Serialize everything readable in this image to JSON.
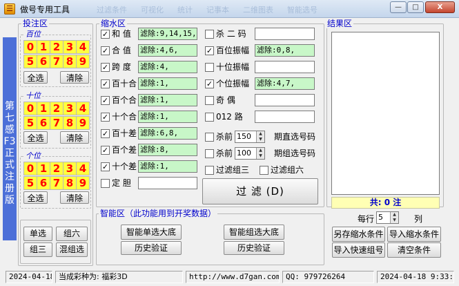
{
  "window": {
    "title": "做号专用工具",
    "app_icon_glyph": "☰",
    "min": "—",
    "max": "□",
    "close": "X"
  },
  "tabs": {
    "items": [
      "过滤条件",
      "可视化",
      "统计",
      "记事本",
      "二维图表",
      "智能选号"
    ]
  },
  "vertical_label": "第七感F3 正式注册版",
  "bet_area": {
    "title": "投注区",
    "groups": [
      {
        "label": "百位",
        "digits": [
          "0",
          "1",
          "2",
          "3",
          "4",
          "5",
          "6",
          "7",
          "8",
          "9"
        ],
        "select_all": "全选",
        "clear": "清除"
      },
      {
        "label": "十位",
        "digits": [
          "0",
          "1",
          "2",
          "3",
          "4",
          "5",
          "6",
          "7",
          "8",
          "9"
        ],
        "select_all": "全选",
        "clear": "清除"
      },
      {
        "label": "个位",
        "digits": [
          "0",
          "1",
          "2",
          "3",
          "4",
          "5",
          "6",
          "7",
          "8",
          "9"
        ],
        "select_all": "全选",
        "clear": "清除"
      }
    ],
    "buttons": {
      "single": "单选",
      "group6": "组六",
      "group3": "组三",
      "mixed": "混组选"
    }
  },
  "filter_area": {
    "title": "缩水区",
    "left": [
      {
        "checked": true,
        "label": "和  值",
        "value": "滤除:9,14,15,"
      },
      {
        "checked": true,
        "label": "合  值",
        "value": "滤除:4,6,"
      },
      {
        "checked": true,
        "label": "跨  度",
        "value": "滤除:4,"
      },
      {
        "checked": true,
        "label": "百十合",
        "value": "滤除:1,"
      },
      {
        "checked": true,
        "label": "百个合",
        "value": "滤除:1,"
      },
      {
        "checked": true,
        "label": "十个合",
        "value": "滤除:1,"
      },
      {
        "checked": true,
        "label": "百十差",
        "value": "滤除:6,8,"
      },
      {
        "checked": true,
        "label": "百个差",
        "value": "滤除:8,"
      },
      {
        "checked": true,
        "label": "十个差",
        "value": "滤除:1,"
      },
      {
        "checked": false,
        "label": "定  胆",
        "value": ""
      }
    ],
    "right": [
      {
        "checked": false,
        "label": "杀 二 码",
        "value": ""
      },
      {
        "checked": true,
        "label": "百位振幅",
        "value": "滤除:0,8,"
      },
      {
        "checked": false,
        "label": "十位振幅",
        "value": ""
      },
      {
        "checked": true,
        "label": "个位振幅",
        "value": "滤除:4,7,"
      },
      {
        "checked": false,
        "label": "奇  偶",
        "value": ""
      },
      {
        "checked": false,
        "label": "012 路",
        "value": ""
      }
    ],
    "kill_rows": [
      {
        "checked": false,
        "prefix": "杀前",
        "value": "150",
        "suffix": "期直选号码"
      },
      {
        "checked": false,
        "prefix": "杀前",
        "value": "100",
        "suffix": "期组选号码"
      }
    ],
    "filter_g3": {
      "checked": false,
      "label": "过滤组三"
    },
    "filter_g6": {
      "checked": false,
      "label": "过滤组六"
    },
    "filter_button": "过  滤 (D)"
  },
  "smart_area": {
    "title": "智能区（此功能用到开奖数据）",
    "single_btn": "智能单选大底",
    "single_verify": "历史验证",
    "group_btn": "智能组选大底",
    "group_verify": "历史验证"
  },
  "result_area": {
    "title": "结果区",
    "total": "共: 0 注",
    "per_row_label": "每行",
    "per_row_value": "5",
    "per_row_unit": "列",
    "buttons": {
      "save_as": "另存缩水条件",
      "import": "导入缩水条件",
      "quick_import": "导入快速组号",
      "clear": "清空条件"
    }
  },
  "status": {
    "date_left": "2024-04-18",
    "lottery": "当成彩种为: 福彩3D",
    "url": "http://www.d7gan.com",
    "qq": "QQ: 979726264",
    "datetime": "2024-04-18  9:33:1"
  }
}
